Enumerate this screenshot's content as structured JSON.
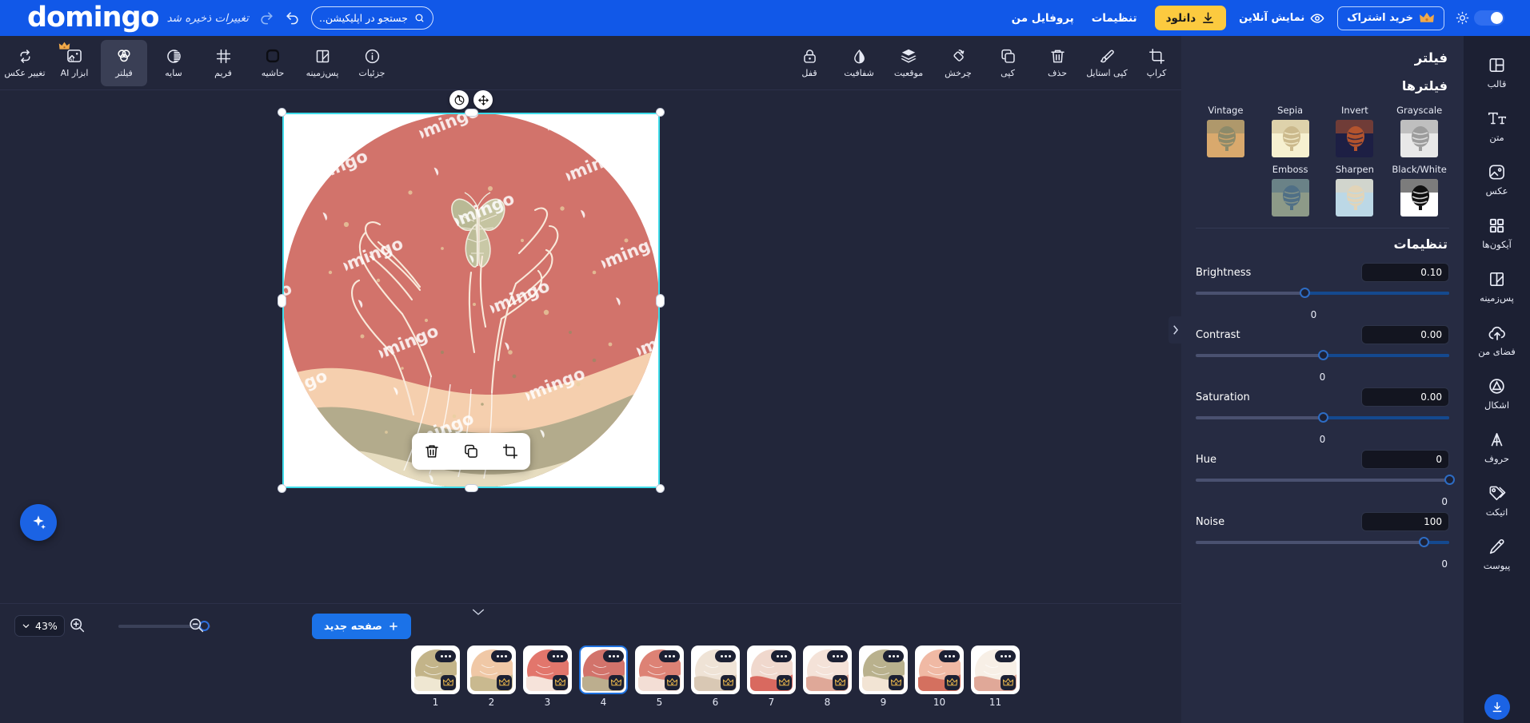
{
  "topbar": {
    "logo": "domingo",
    "saved_text": "تغییرات ذخیره شد",
    "search_placeholder": "جستجو در اپلیکیشن...",
    "subscribe_label": "خرید اشتراک",
    "online_preview_label": "نمایش آنلاین",
    "download_label": "دانلود",
    "settings_label": "تنظیمات",
    "profile_label": "پروفایل من"
  },
  "toolbar": {
    "left_tools": [
      {
        "label": "کراپ",
        "icon": "crop-icon"
      },
      {
        "label": "کپی استایل",
        "icon": "brush-icon"
      },
      {
        "label": "حذف",
        "icon": "trash-icon"
      },
      {
        "label": "کپی",
        "icon": "duplicate-icon"
      },
      {
        "label": "چرخش",
        "icon": "rotate-icon"
      },
      {
        "label": "موقعیت",
        "icon": "layers-icon"
      },
      {
        "label": "شفافیت",
        "icon": "opacity-drop-icon"
      },
      {
        "label": "قفل",
        "icon": "lock-icon"
      }
    ],
    "right_tools": [
      {
        "label": "جزئیات",
        "icon": "info-icon",
        "active": false
      },
      {
        "label": "پس‌زمینه",
        "icon": "background-icon",
        "active": false
      },
      {
        "label": "حاشیه",
        "icon": "border-icon",
        "active": false
      },
      {
        "label": "فریم",
        "icon": "frame-icon",
        "active": false
      },
      {
        "label": "سایه",
        "icon": "shadow-icon",
        "active": false
      },
      {
        "label": "فیلتر",
        "icon": "filter-icon",
        "active": true
      },
      {
        "label": "ابزار AI",
        "icon": "ai-tools-icon",
        "active": false,
        "premium": true
      },
      {
        "label": "تغییر عکس",
        "icon": "swap-image-icon",
        "active": false
      }
    ]
  },
  "canvas": {
    "watermark_text": "domingo",
    "float_tools": [
      {
        "name": "crop",
        "icon": "crop-icon"
      },
      {
        "name": "duplicate",
        "icon": "duplicate-icon"
      },
      {
        "name": "delete",
        "icon": "trash-icon"
      }
    ],
    "move_label": "move-handle",
    "rotate_label": "rotate-handle"
  },
  "bottombar": {
    "zoom_level": "43%",
    "new_page_label": "صفحه جدید",
    "pages": [
      "1",
      "2",
      "3",
      "4",
      "5",
      "6",
      "7",
      "8",
      "9",
      "10",
      "11"
    ],
    "selected_page": "4"
  },
  "right_panel": {
    "header": "فیلتر",
    "filters_title": "فیلترها",
    "filters": [
      {
        "label": "Vintage",
        "c1": "#d9a96d",
        "c2": "#8c8a6a"
      },
      {
        "label": "Sepia",
        "c1": "#f6f0d0",
        "c2": "#cbb98c"
      },
      {
        "label": "Invert",
        "c1": "#1d1f44",
        "c2": "#b4542e"
      },
      {
        "label": "Grayscale",
        "c1": "#e8e8e8",
        "c2": "#9c9c9c"
      },
      {
        "label": "Emboss",
        "c1": "#8d9a88",
        "c2": "#4f6f86"
      },
      {
        "label": "Sharpen",
        "c1": "#bcd8e6",
        "c2": "#e2d4b8"
      },
      {
        "label": "Black/White",
        "c1": "#ffffff",
        "c2": "#101010"
      }
    ],
    "adjustments_title": "تنظیمات",
    "adjustments": [
      {
        "label": "Brightness",
        "value": "0.10",
        "sub": "0",
        "pos": 43,
        "align": "center"
      },
      {
        "label": "Contrast",
        "value": "0.00",
        "sub": "0",
        "pos": 50,
        "align": "center"
      },
      {
        "label": "Saturation",
        "value": "0.00",
        "sub": "0",
        "pos": 50,
        "align": "center"
      },
      {
        "label": "Hue",
        "value": "0",
        "sub": "0",
        "pos": 100,
        "align": "right"
      },
      {
        "label": "Noise",
        "value": "100",
        "sub": "0",
        "pos": 90,
        "align": "right"
      }
    ]
  },
  "sidebar": {
    "items": [
      {
        "label": "قالب",
        "icon": "template-icon"
      },
      {
        "label": "متن",
        "icon": "text-icon"
      },
      {
        "label": "عکس",
        "icon": "image-icon"
      },
      {
        "label": "آیکون‌ها",
        "icon": "icons-grid-icon"
      },
      {
        "label": "پس‌زمینه",
        "icon": "background-icon"
      },
      {
        "label": "فضای من",
        "icon": "cloud-upload-icon"
      },
      {
        "label": "اشکال",
        "icon": "shapes-icon"
      },
      {
        "label": "حروف",
        "icon": "letters-icon"
      },
      {
        "label": "اتیکت",
        "icon": "tag-icon"
      },
      {
        "label": "پیوست",
        "icon": "pencil-icon"
      }
    ]
  },
  "colors": {
    "brand_blue": "#1158e8",
    "accent_yellow": "#fcca3f",
    "panel_bg": "#262b42",
    "toolbar_bg": "#22263a",
    "sidebar_bg": "#1c2033",
    "selection_cyan": "#3fdcea"
  }
}
